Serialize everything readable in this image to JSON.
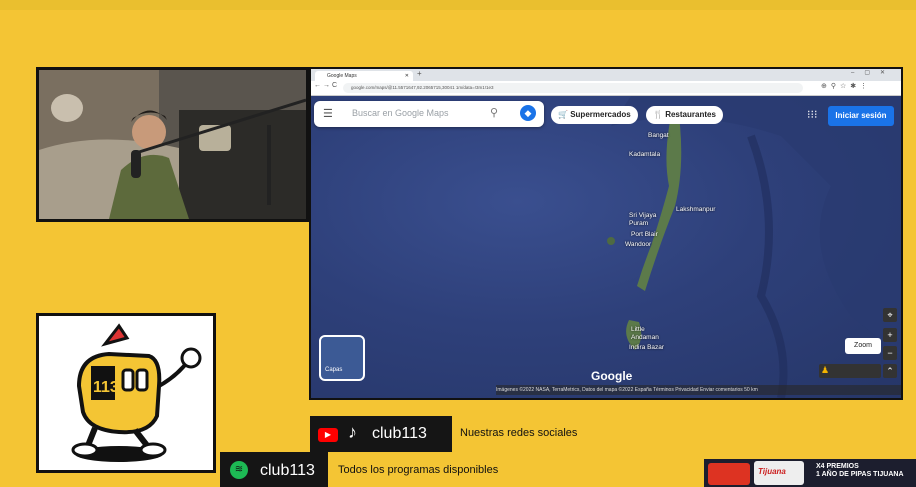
{
  "browser": {
    "tab_title": "Google Maps",
    "url": "google.com/maps/@11.5571647,92.2065715,30041 1m/data=!3m1!1e3",
    "search_placeholder": "Buscar en Google Maps",
    "chips": [
      "Supermercados",
      "Restaurantes"
    ],
    "signin_label": "Iniciar sesión",
    "layers_label": "Capas",
    "zoom_tooltip": "Zoom",
    "google_logo": "Google",
    "footer_text": "Imágenes ©2022 NASA, TerraMetrics, Datos del mapa ©2022    España    Términos    Privacidad    Enviar comentarios    50 km",
    "places": [
      {
        "name": "Bangat"
      },
      {
        "name": "Kadamtala"
      },
      {
        "name": "Lakshmanpur"
      },
      {
        "name": "Sri Vijaya Puram"
      },
      {
        "name": "Port Blair"
      },
      {
        "name": "Wandoor"
      },
      {
        "name": "Little Andaman"
      },
      {
        "name": "Indira Bazar"
      }
    ]
  },
  "stream": {
    "tiktok_handle": "club113",
    "redes_text": "Nuestras redes sociales",
    "spotify_handle": "club113",
    "programas_text": "Todos los programas disponibles",
    "ad_text_line1": "X4 PREMIOS",
    "ad_text_line2": "1 AÑO DE PIPAS TIJUANA",
    "ad_brand": "Tijuana",
    "logo_number": "113"
  },
  "colors": {
    "background": "#f4c534",
    "map_ocean": "#2e407a",
    "signin_blue": "#1a73e8",
    "youtube_red": "#ff0000",
    "spotify_green": "#1db954"
  }
}
